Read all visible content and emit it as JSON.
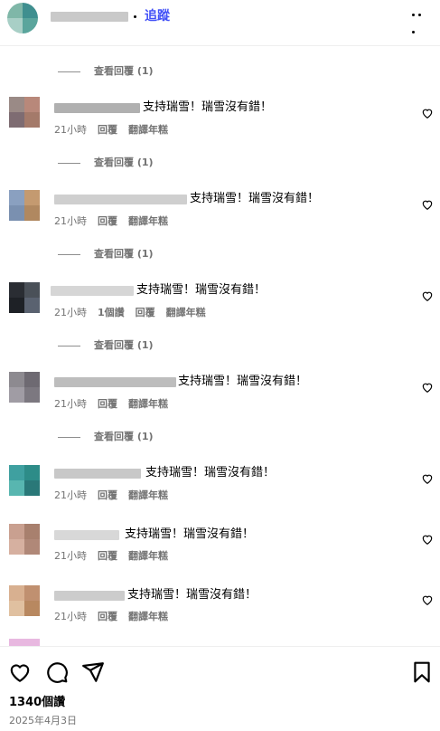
{
  "header": {
    "follow_label": "追蹤"
  },
  "view_replies_label": "查看回覆 (1)",
  "comments": [
    {
      "text": "支持瑞雪！瑞雪沒有錯！",
      "time": "21小時",
      "likes": "",
      "reply": "回覆",
      "translate": "翻譯年糕",
      "avatar_colors": [
        "#9a8a86",
        "#b8887a",
        "#7e6c72",
        "#a47a6a"
      ],
      "name_color": "#b0b0b0"
    },
    {
      "text": "支持瑞雪！瑞雪沒有錯！",
      "time": "21小時",
      "likes": "",
      "reply": "回覆",
      "translate": "翻譯年糕",
      "avatar_colors": [
        "#8aa0c0",
        "#c49a70",
        "#7a90b0",
        "#b08860"
      ],
      "name_color": "#cfcfcf"
    },
    {
      "text": "支持瑞雪！瑞雪沒有錯！",
      "time": "21小時",
      "likes": "1個讚",
      "reply": "回覆",
      "translate": "翻譯年糕",
      "avatar_colors": [
        "#2a2d33",
        "#4a5058",
        "#1e2126",
        "#5a6270"
      ],
      "name_color": "#d6d6d6"
    },
    {
      "text": "支持瑞雪！瑞雪沒有錯！",
      "time": "21小時",
      "likes": "",
      "reply": "回覆",
      "translate": "翻譯年糕",
      "avatar_colors": [
        "#8d8a90",
        "#6e6a72",
        "#a09ca4",
        "#7c7880"
      ],
      "name_color": "#bdbdbd"
    },
    {
      "text": "支持瑞雪！瑞雪沒有錯！",
      "time": "21小時",
      "likes": "",
      "reply": "回覆",
      "translate": "翻譯年糕",
      "avatar_colors": [
        "#3fa0a0",
        "#2d8c88",
        "#58b6b0",
        "#2a7878"
      ],
      "name_color": "#c8c8c8"
    },
    {
      "text": "支持瑞雪！瑞雪沒有錯！",
      "time": "21小時",
      "likes": "",
      "reply": "回覆",
      "translate": "翻譯年糕",
      "avatar_colors": [
        "#c9a090",
        "#a8806e",
        "#d6b0a0",
        "#b08878"
      ],
      "name_color": "#d8d8d8"
    },
    {
      "text": "支持瑞雪！瑞雪沒有錯！",
      "time": "21小時",
      "likes": "",
      "reply": "回覆",
      "translate": "翻譯年糕",
      "avatar_colors": [
        "#d8b090",
        "#c09070",
        "#e0c0a0",
        "#b88860"
      ],
      "name_color": "#cccccc"
    }
  ],
  "footer": {
    "likes_count": "1340個讚",
    "date": "2025年4月3日"
  }
}
